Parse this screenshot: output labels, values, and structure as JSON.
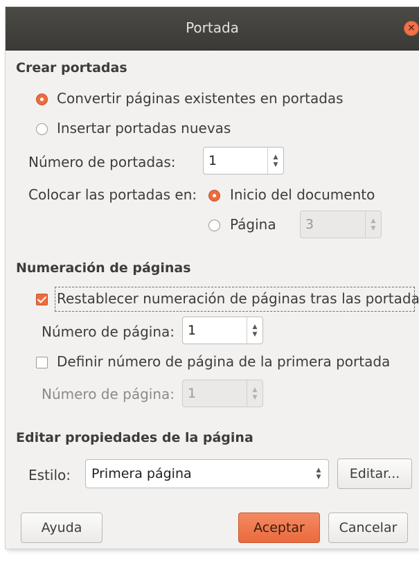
{
  "window": {
    "title": "Portada"
  },
  "crear": {
    "heading": "Crear portadas",
    "opt_convertir": "Convertir páginas existentes en portadas",
    "opt_insertar": "Insertar portadas nuevas",
    "num_portadas_label": "Número de portadas:",
    "num_portadas_value": "1",
    "colocar_label": "Colocar las portadas en:",
    "opt_inicio": "Inicio del documento",
    "opt_pagina": "Página",
    "pagina_value": "3"
  },
  "numeracion": {
    "heading": "Numeración de páginas",
    "restablecer": "Restablecer numeración de páginas tras las portadas",
    "num_pagina_label": "Número de página:",
    "num_pagina_value": "1",
    "definir": "Definir número de página de la primera portada",
    "num_pagina2_label": "Número de página:",
    "num_pagina2_value": "1"
  },
  "editar": {
    "heading": "Editar propiedades de la página",
    "estilo_label": "Estilo:",
    "estilo_value": "Primera página",
    "editar_button": "Editar..."
  },
  "buttons": {
    "ayuda": "Ayuda",
    "aceptar": "Aceptar",
    "cancelar": "Cancelar"
  },
  "colors": {
    "accent": "#ee6b3f",
    "titlebar": "#3d3c38"
  }
}
